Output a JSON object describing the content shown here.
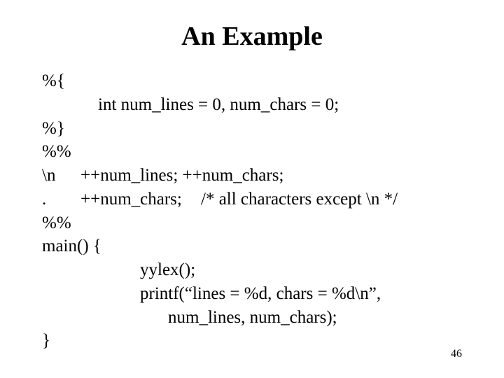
{
  "title": "An Example",
  "code": {
    "l1_c1": "%{",
    "l2_c2": "int num_lines = 0, num_chars = 0;",
    "l3_c1": "%}",
    "l4_c1": "%%",
    "l5_c1": "\\n",
    "l5_c2": "++num_lines; ++num_chars;",
    "l6_c1": ".",
    "l6_c2": "++num_chars;",
    "l6_c3": "/* all characters except \\n */",
    "l7_c1": "%%",
    "l8": "main() {",
    "l9": "yylex();",
    "l10": "printf(“lines = %d, chars = %d\\n”,",
    "l11": "num_lines, num_chars);",
    "l12": "}"
  },
  "page_number": "46"
}
